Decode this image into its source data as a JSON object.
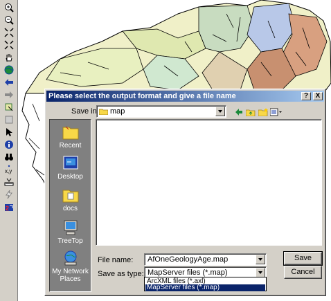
{
  "dialog": {
    "title": "Please select the output format and give a file name",
    "help_label": "?",
    "close_label": "X",
    "save_in_label": "Save in:",
    "save_in_value": "map",
    "file_name_label": "File name:",
    "file_name_value": "AfOneGeologyAge.map",
    "save_as_type_label": "Save as type:",
    "save_as_type_value": "MapServer files (*.map)",
    "type_options": [
      "ArcXML files (*.axl)",
      "MapServer files (*.map)"
    ],
    "save_button": "Save",
    "cancel_button": "Cancel"
  },
  "places": [
    {
      "label": "Recent",
      "icon": "recent-folder-icon"
    },
    {
      "label": "Desktop",
      "icon": "desktop-icon"
    },
    {
      "label": "docs",
      "icon": "docs-folder-icon"
    },
    {
      "label": "TreeTop",
      "icon": "computer-icon"
    },
    {
      "label": "My Network Places",
      "icon": "network-places-icon"
    }
  ],
  "toolbar_icons": [
    "zoom-in-icon",
    "zoom-out-icon",
    "zoom-full-icon",
    "zoom-fixed-icon",
    "pan-hand-icon",
    "globe-icon",
    "back-arrow-icon",
    "forward-arrow-icon",
    "identify-feature-icon",
    "select-icon",
    "pointer-icon",
    "info-icon",
    "find-binoculars-icon",
    "xy-coordinates-icon",
    "measure-icon",
    "hyperlink-lightning-icon",
    "export-map-icon"
  ],
  "colors": {
    "titlebar_start": "#0a246a",
    "titlebar_end": "#a6caf0",
    "dialog_face": "#d4d0c8",
    "selection": "#0a246a",
    "places_bg": "#808080"
  }
}
